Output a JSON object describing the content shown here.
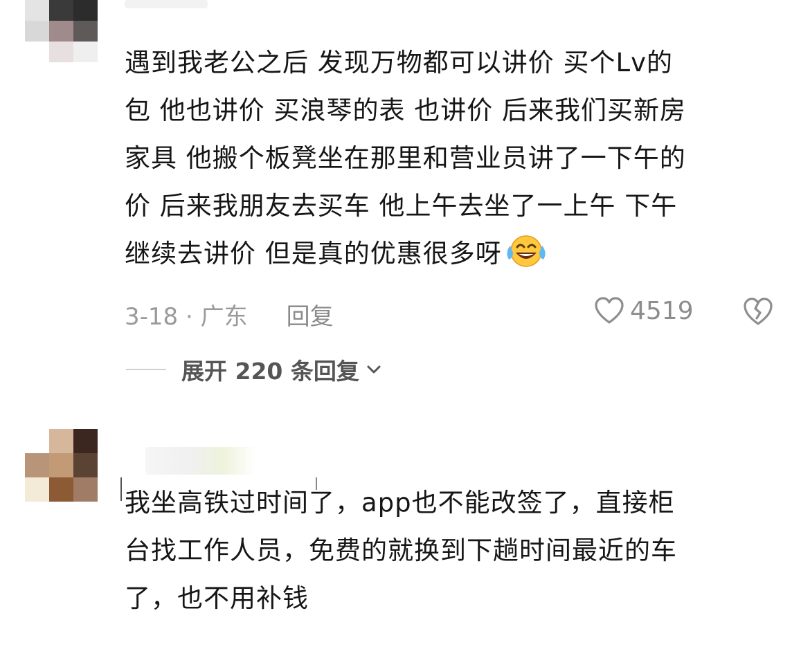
{
  "comments": [
    {
      "text": "遇到我老公之后 发现万物都可以讲价 买个Lv的\n包 他也讲价 买浪琴的表 也讲价 后来我们买新房\n家具 他搬个板凳坐在那里和营业员讲了一下午的\n价 后来我朋友去买车 他上午去坐了一上午 下午\n继续去讲价 但是真的优惠很多呀",
      "emoji": "laughing-tears-emoji",
      "date_location": "3-18 · 广东",
      "reply_label": "回复",
      "like_count": "4519",
      "expand_label": "展开 220 条回复"
    },
    {
      "text": "我坐高铁过时间了，app也不能改签了，直接柜\n台找工作人员，免费的就换到下趟时间最近的车\n了，也不用补钱"
    }
  ],
  "colors": {
    "text": "#161616",
    "meta": "#9a9a9a",
    "icon": "#8d8d8d"
  }
}
